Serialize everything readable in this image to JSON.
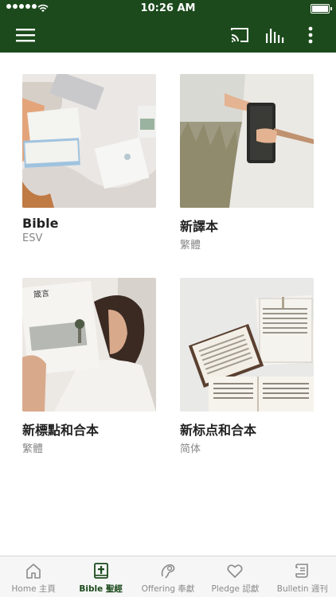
{
  "status_bar": {
    "time": "10:26 AM"
  },
  "app_bar": {
    "icons": [
      "menu-icon",
      "cast-icon",
      "audio-bars-icon",
      "more-vertical-icon"
    ]
  },
  "colors": {
    "primary": "#1c4a1c",
    "tab_inactive": "#8a8a8a",
    "subtitle": "#888888"
  },
  "cards": [
    {
      "title": "Bible",
      "subtitle": "ESV"
    },
    {
      "title": "新譯本",
      "subtitle": "繁體"
    },
    {
      "title": "新標點和合本",
      "subtitle": "繁體"
    },
    {
      "title": "新标点和合本",
      "subtitle": "简体"
    }
  ],
  "tabs": [
    {
      "label": "Home 主頁",
      "icon": "home-icon",
      "active": false
    },
    {
      "label": "Bible 聖經",
      "icon": "bible-cross-icon",
      "active": true
    },
    {
      "label": "Offering 奉獻",
      "icon": "offering-icon",
      "active": false
    },
    {
      "label": "Pledge 認獻",
      "icon": "heart-icon",
      "active": false
    },
    {
      "label": "Bulletin 週刊",
      "icon": "scroll-icon",
      "active": false
    }
  ]
}
